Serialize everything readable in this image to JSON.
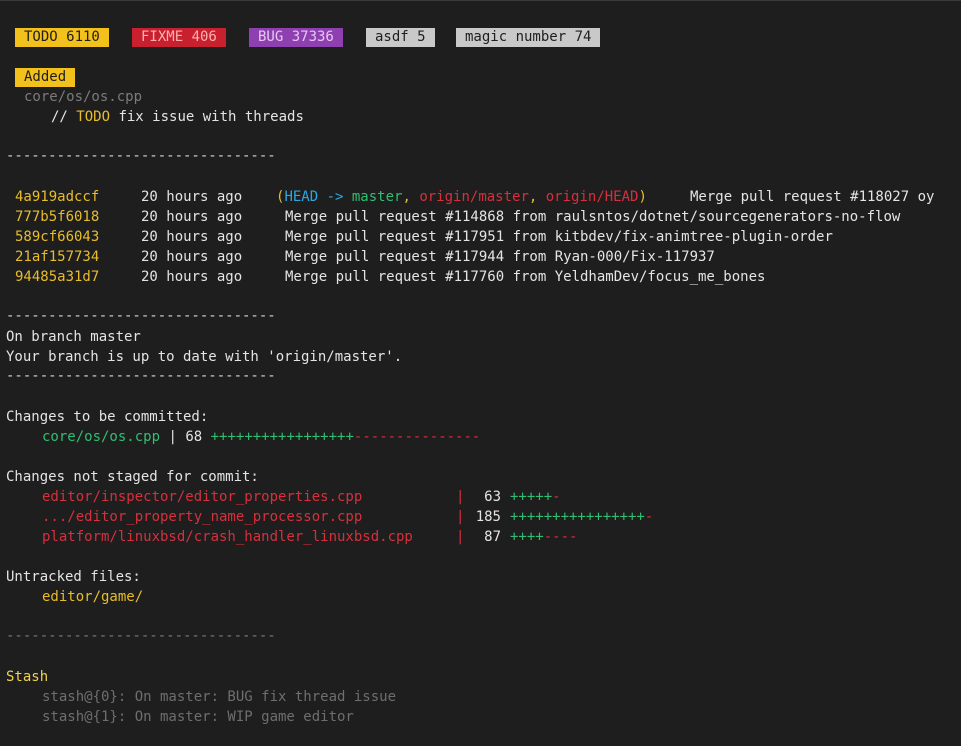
{
  "badges": {
    "todo": "TODO 6110",
    "fixme": "FIXME 406",
    "bug": "BUG 37336",
    "asdf": "asdf 5",
    "magic": "magic number 74"
  },
  "added": {
    "label": "Added",
    "file": "core/os/os.cpp",
    "comment_prefix": "// ",
    "comment_tag": "TODO",
    "comment_text": " fix issue with threads"
  },
  "separator": "--------------------------------",
  "commits": [
    {
      "hash": "4a919adccf",
      "time": "20 hours ago",
      "msg": "Merge pull request #118027 oy"
    },
    {
      "hash": "777b5f6018",
      "time": "20 hours ago",
      "msg": "Merge pull request #114868 from raulsntos/dotnet/sourcegenerators-no-flow"
    },
    {
      "hash": "589cf66043",
      "time": "20 hours ago",
      "msg": "Merge pull request #117951 from kitbdev/fix-animtree-plugin-order"
    },
    {
      "hash": "21af157734",
      "time": "20 hours ago",
      "msg": "Merge pull request #117944 from Ryan-000/Fix-117937"
    },
    {
      "hash": "94485a31d7",
      "time": "20 hours ago",
      "msg": "Merge pull request #117760 from YeldhamDev/focus_me_bones"
    }
  ],
  "refs": {
    "open": "(",
    "head": "HEAD",
    "arrow": " -> ",
    "master": "master",
    "comma1": ", ",
    "origin_master": "origin/master",
    "comma2": ", ",
    "origin_head": "origin/HEAD",
    "close": ")"
  },
  "status": {
    "branch_line": "On branch master",
    "uptodate_line": "Your branch is up to date with 'origin/master'."
  },
  "staged": {
    "header": "Changes to be committed:",
    "files": [
      {
        "path": "core/os/os.cpp",
        "sep": " | ",
        "count": "68",
        "plus": "+++++++++++++++++",
        "minus": "---------------"
      }
    ]
  },
  "unstaged": {
    "header": "Changes not staged for commit:",
    "files": [
      {
        "path": "editor/inspector/editor_properties.cpp",
        "count": "63",
        "plus": "+++++",
        "minus": "-"
      },
      {
        "path": ".../editor_property_name_processor.cpp",
        "count": "185",
        "plus": "++++++++++++++++",
        "minus": "-"
      },
      {
        "path": "platform/linuxbsd/crash_handler_linuxbsd.cpp",
        "count": "87",
        "plus": "++++",
        "minus": "----"
      }
    ]
  },
  "untracked": {
    "header": "Untracked files:",
    "files": [
      "editor/game/"
    ]
  },
  "stash": {
    "header": "Stash",
    "items": [
      "stash@{0}: On master: BUG fix thread issue",
      "stash@{1}: On master: WIP game editor"
    ]
  },
  "colors": {
    "background": "#1e1e1f",
    "todo": "#f3c11b",
    "fixme": "#c8202e",
    "bug": "#8e3fb0",
    "neutral_badge": "#c9c9c9",
    "green": "#2fbf71",
    "red": "#d6303c",
    "yellow": "#e8bd2a",
    "cyan": "#2aa8e0"
  }
}
